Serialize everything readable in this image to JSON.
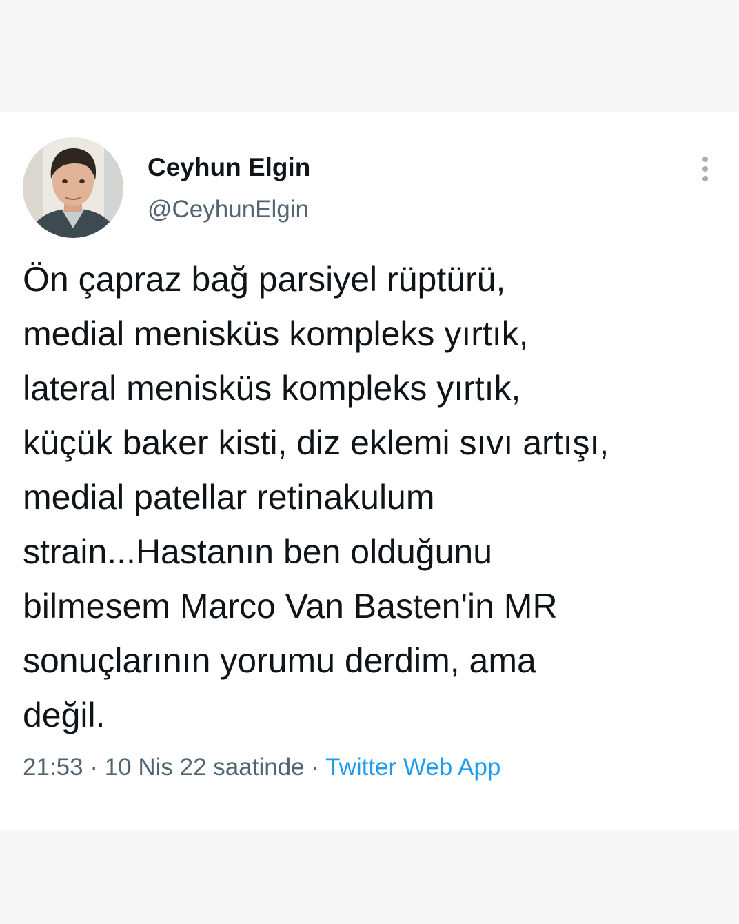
{
  "tweet": {
    "author": {
      "display_name": "Ceyhun Elgin",
      "handle": "@CeyhunElgin",
      "avatar": "profile-photo"
    },
    "more_icon": "more-vertical-icon",
    "text_lines": [
      "Ön çapraz bağ parsiyel rüptürü,",
      "medial menisküs kompleks yırtık,",
      "lateral menisküs kompleks yırtık,",
      "küçük baker kisti, diz eklemi sıvı artışı,",
      "medial patellar retinakulum",
      "strain...Hastanın ben olduğunu",
      "bilmesem Marco Van Basten'in MR",
      "sonuçlarının yorumu derdim, ama",
      "değil."
    ],
    "time": "21:53",
    "separator": "·",
    "date": "10 Nis 22 saatinde",
    "source": "Twitter Web App"
  },
  "colors": {
    "text": "#0f1419",
    "secondary": "#536471",
    "link": "#1d9bf0",
    "page_background": "#f7f7f7",
    "card_background": "#ffffff"
  }
}
